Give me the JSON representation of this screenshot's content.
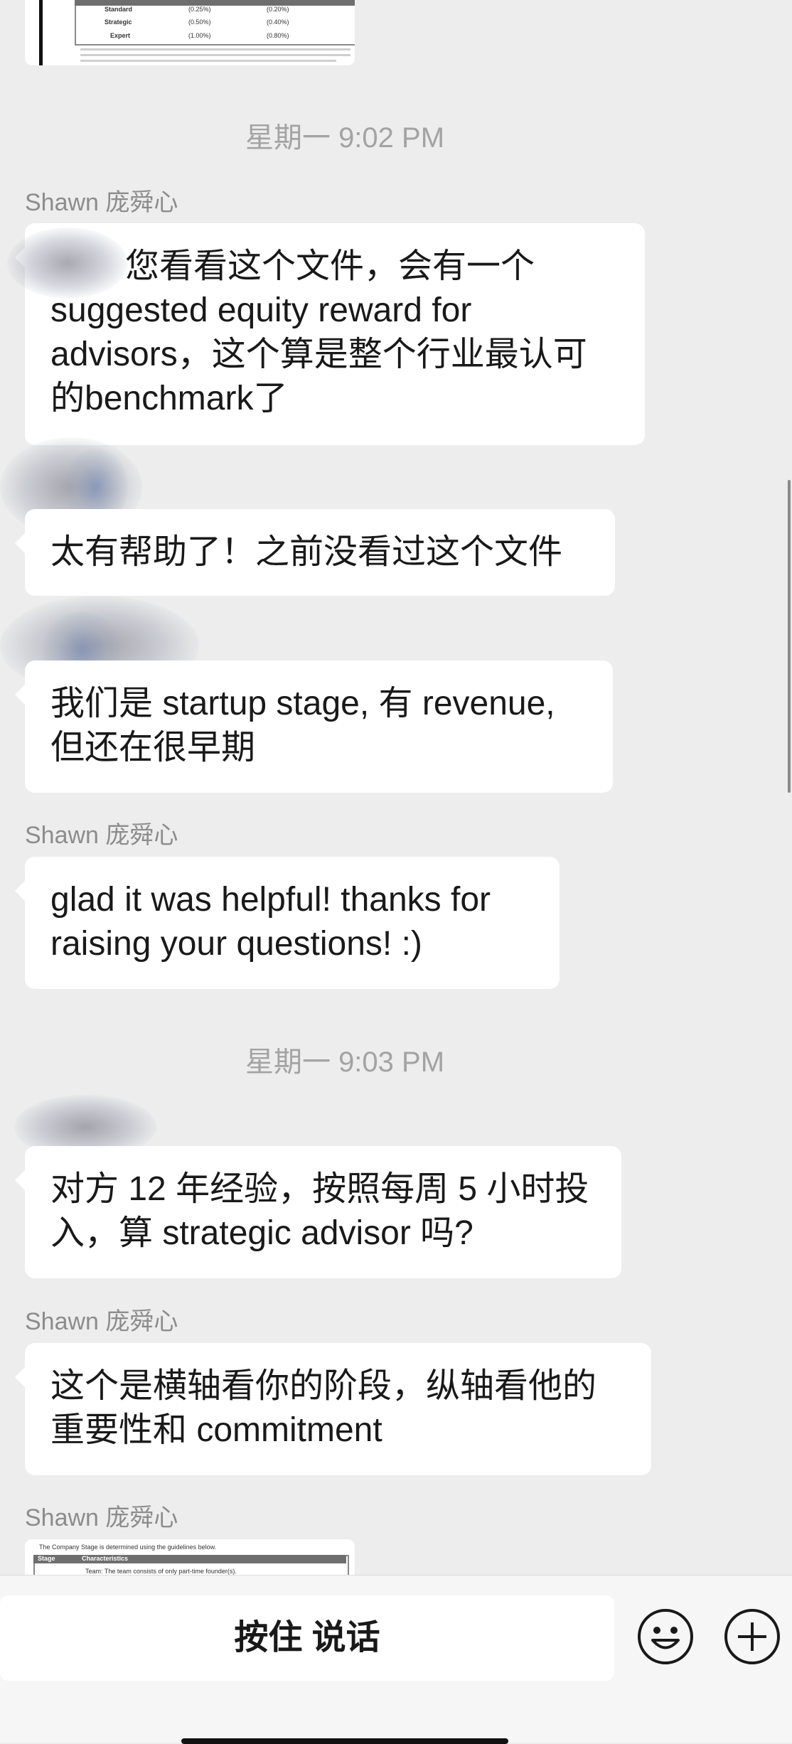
{
  "messages": {
    "timestamp_1": "星期一 9:02 PM",
    "sender_1": "Shawn 庞舜心",
    "msg_1": "您看看这个文件，会有一个suggested equity reward for advisors，这个算是整个行业最认可的benchmark了",
    "msg_2": "太有帮助了！之前没看过这个文件",
    "msg_3": "我们是 startup stage, 有 revenue, 但还在很早期",
    "sender_2": "Shawn 庞舜心",
    "msg_4": "glad it was helpful! thanks for raising your questions! :)",
    "timestamp_2": "星期一 9:03 PM",
    "msg_5": "对方 12 年经验，按照每周 5 小时投入，算 strategic advisor 吗?",
    "sender_3": "Shawn 庞舜心",
    "msg_6": "这个是横轴看你的阶段，纵轴看他的重要性和 commitment",
    "sender_4": "Shawn 庞舜心"
  },
  "doc_top": {
    "rows": [
      "Standard",
      "Strategic",
      "Expert"
    ],
    "cells": [
      "(0.25%)",
      "(0.20%)",
      "(0.50%)",
      "(0.40%)",
      "(1.00%)",
      "(0.80%)"
    ]
  },
  "doc_bottom": {
    "caption": "The Company Stage is determined using the guidelines below.",
    "col_1": "Stage",
    "col_2": "Characteristics",
    "row_text": "Team: The team consists of only part-time founder(s)."
  },
  "input_bar": {
    "talk_label": "按住 说话",
    "emoji_icon": "emoji-icon",
    "plus_icon": "plus-icon"
  },
  "colors": {
    "background": "#ededed",
    "bubble": "#ffffff",
    "timestamp": "#a3a3a3",
    "sender": "#8c8c8c"
  }
}
